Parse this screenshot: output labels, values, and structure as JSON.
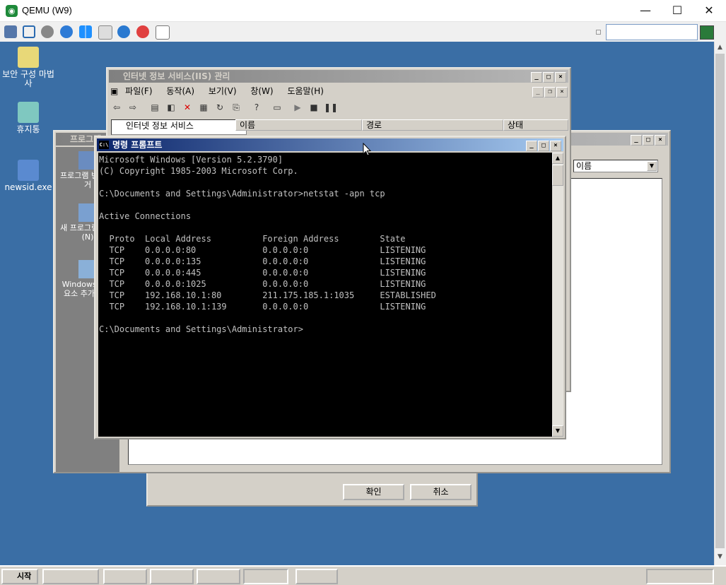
{
  "host": {
    "title": "QEMU (W9)",
    "minimize": "—",
    "maximize": "☐",
    "close": "✕"
  },
  "desktop_icons": [
    {
      "label": "보안 구성 마법사"
    },
    {
      "label": "휴지통"
    },
    {
      "label": "newsid.exe"
    }
  ],
  "iis": {
    "title": "인터넷 정보 서비스(IIS) 관리",
    "menu": [
      "파일(F)",
      "동작(A)",
      "보기(V)",
      "창(W)",
      "도움말(H)"
    ],
    "tree_root": "인터넷 정보 서비스",
    "columns": [
      "이름",
      "경로",
      "상태"
    ]
  },
  "programs": {
    "title": "프로그램 추가/제거",
    "nav": [
      {
        "label": "프로그램 변경/제거"
      },
      {
        "label": "새 프로그램 추가(N)"
      },
      {
        "label": "Windows 구성 요소 추가/제거"
      }
    ],
    "sort_value": "이름"
  },
  "dialog": {
    "ok": "확인",
    "cancel": "취소"
  },
  "cmd": {
    "title": "명령 프롬프트",
    "icon": "C:\\",
    "text": "Microsoft Windows [Version 5.2.3790]\n(C) Copyright 1985-2003 Microsoft Corp.\n\nC:\\Documents and Settings\\Administrator>netstat -apn tcp\n\nActive Connections\n\n  Proto  Local Address          Foreign Address        State\n  TCP    0.0.0.0:80             0.0.0.0:0              LISTENING\n  TCP    0.0.0.0:135            0.0.0.0:0              LISTENING\n  TCP    0.0.0.0:445            0.0.0.0:0              LISTENING\n  TCP    0.0.0.0:1025           0.0.0.0:0              LISTENING\n  TCP    192.168.10.1:80        211.175.185.1:1035     ESTABLISHED\n  TCP    192.168.10.1:139       0.0.0.0:0              LISTENING\n\nC:\\Documents and Settings\\Administrator>"
  },
  "taskbar": {
    "start": "시작"
  },
  "colors": {
    "desktop": "#3a6ea5",
    "active_caption": "#0a246a",
    "console_bg": "#000000",
    "console_fg": "#c0c0c0"
  }
}
